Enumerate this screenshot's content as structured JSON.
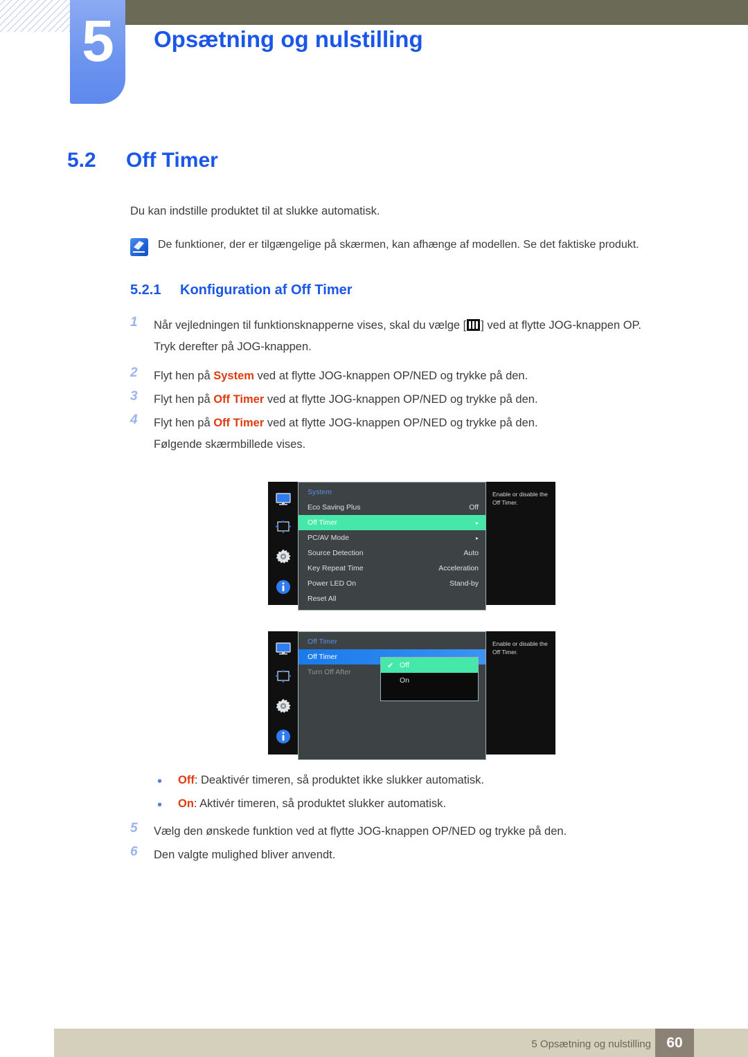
{
  "header": {
    "chapter_number": "5",
    "chapter_title": "Opsætning og nulstilling"
  },
  "section": {
    "number": "5.2",
    "title": "Off Timer",
    "intro": "Du kan indstille produktet til at slukke automatisk.",
    "note_icon": "note-icon",
    "note_text": "De funktioner, der er tilgængelige på skærmen, kan afhænge af modellen. Se det faktiske produkt."
  },
  "subsection": {
    "number": "5.2.1",
    "title": "Konfiguration af Off Timer"
  },
  "steps": {
    "s1_num": "1",
    "s1_a": "Når vejledningen til funktionsknapperne vises, skal du vælge [",
    "s1_b": "] ved at flytte JOG-knappen OP.",
    "s1_line2": "Tryk derefter på JOG-knappen.",
    "s2_num": "2",
    "s2_a": "Flyt hen på ",
    "s2_kw": "System",
    "s2_b": " ved at flytte JOG-knappen OP/NED og trykke på den.",
    "s3_num": "3",
    "s3_a": "Flyt hen på ",
    "s3_kw": "Off Timer",
    "s3_b": " ved at flytte JOG-knappen OP/NED og trykke på den.",
    "s4_num": "4",
    "s4_a": "Flyt hen på ",
    "s4_kw": "Off Timer",
    "s4_b": " ved at flytte JOG-knappen OP/NED og trykke på den.",
    "s4_line2": "Følgende skærmbillede vises.",
    "s5_num": "5",
    "s5_text": "Vælg den ønskede funktion ved at flytte JOG-knappen OP/NED og trykke på den.",
    "s6_num": "6",
    "s6_text": "Den valgte mulighed bliver anvendt."
  },
  "bullets": {
    "b1_kw": "Off",
    "b1_text": ": Deaktivér timeren, så produktet ikke slukker automatisk.",
    "b2_kw": "On",
    "b2_text": ": Aktivér timeren, så produktet slukker automatisk."
  },
  "osd1": {
    "icons": [
      "monitor-icon",
      "screen-adjust-icon",
      "gear-icon",
      "info-icon"
    ],
    "title": "System",
    "rows": [
      {
        "label": "Eco Saving Plus",
        "value": "Off",
        "arrow": ""
      },
      {
        "label": "Off Timer",
        "value": "",
        "arrow": "▸"
      },
      {
        "label": "PC/AV Mode",
        "value": "",
        "arrow": "▸"
      },
      {
        "label": "Source Detection",
        "value": "Auto",
        "arrow": ""
      },
      {
        "label": "Key Repeat Time",
        "value": "Acceleration",
        "arrow": ""
      },
      {
        "label": "Power LED On",
        "value": "Stand-by",
        "arrow": ""
      },
      {
        "label": "Reset All",
        "value": "",
        "arrow": ""
      }
    ],
    "help_line1": "Enable or disable the",
    "help_line2": "Off Timer."
  },
  "osd2": {
    "icons": [
      "monitor-icon",
      "screen-adjust-icon",
      "gear-icon",
      "info-icon"
    ],
    "title": "Off Timer",
    "rows": [
      {
        "label": "Off Timer"
      },
      {
        "label": "Turn Off After"
      }
    ],
    "options": [
      {
        "label": "Off",
        "check": "✔"
      },
      {
        "label": "On",
        "check": ""
      }
    ],
    "help_line1": "Enable or disable the",
    "help_line2": "Off Timer."
  },
  "footer": {
    "text": "5 Opsætning og nulstilling",
    "page": "60"
  },
  "colors": {
    "accent_blue": "#1a56e8",
    "keyword_orange": "#e03a10",
    "osd_green": "#45e8a8",
    "osd_blue": "#1a7ae8",
    "olive": "#6b6a56",
    "footer_beige": "#d5d0bc",
    "footer_page_bg": "#8b8275"
  }
}
